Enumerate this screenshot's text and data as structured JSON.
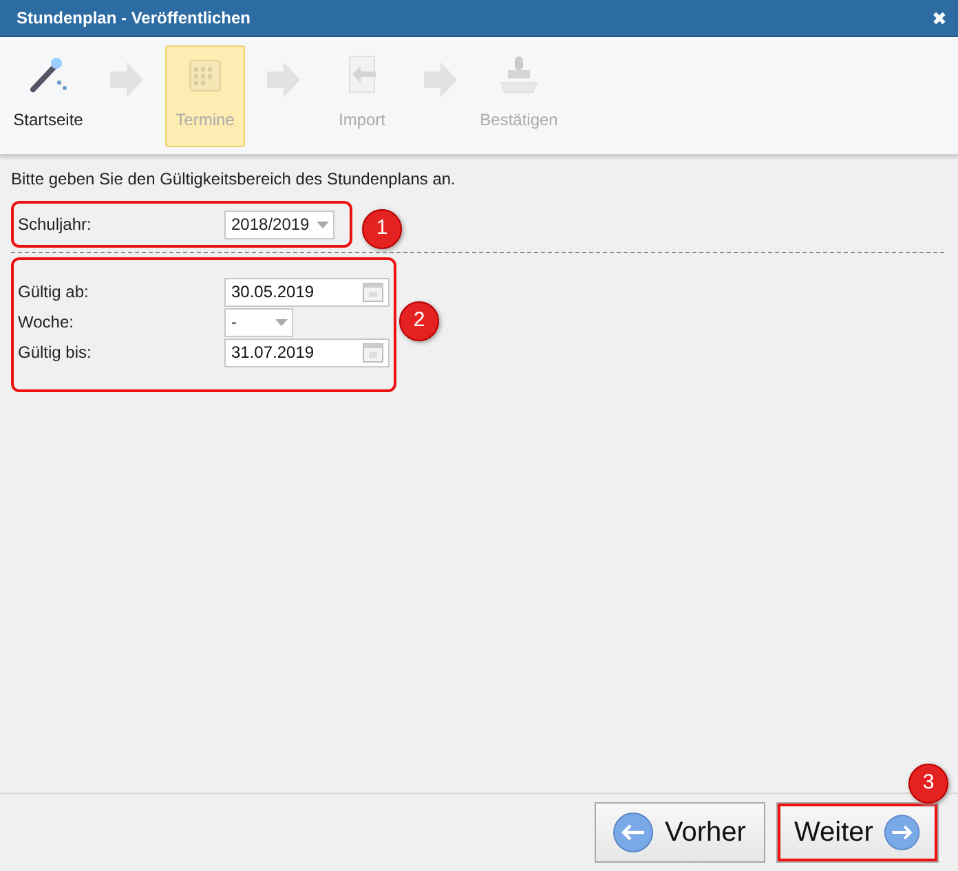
{
  "window": {
    "title": "Stundenplan - Veröffentlichen",
    "close": "✖"
  },
  "steps": [
    {
      "label": "Startseite",
      "kind": "wand",
      "selected": false,
      "disabled": false
    },
    {
      "label": "Termine",
      "kind": "calendar",
      "selected": true,
      "disabled": true
    },
    {
      "label": "Import",
      "kind": "import",
      "selected": false,
      "disabled": true
    },
    {
      "label": "Bestätigen",
      "kind": "stamp",
      "selected": false,
      "disabled": true
    }
  ],
  "instruction": "Bitte geben Sie den Gültigkeitsbereich des Stundenplans an.",
  "groups": [
    {
      "callout": "1",
      "fields": [
        {
          "kind": "select",
          "label": "Schuljahr:",
          "value": "2018/2019"
        }
      ]
    },
    {
      "callout": "2",
      "fields": [
        {
          "kind": "date",
          "label": "Gültig ab:",
          "value": "30.05.2019"
        },
        {
          "kind": "select",
          "label": "Woche:",
          "value": "-"
        },
        {
          "kind": "date",
          "label": "Gültig bis:",
          "value": "31.07.2019"
        }
      ]
    }
  ],
  "buttons": [
    {
      "label": "Vorher",
      "kind": "back"
    },
    {
      "label": "Weiter",
      "kind": "next",
      "callout": "3"
    }
  ]
}
